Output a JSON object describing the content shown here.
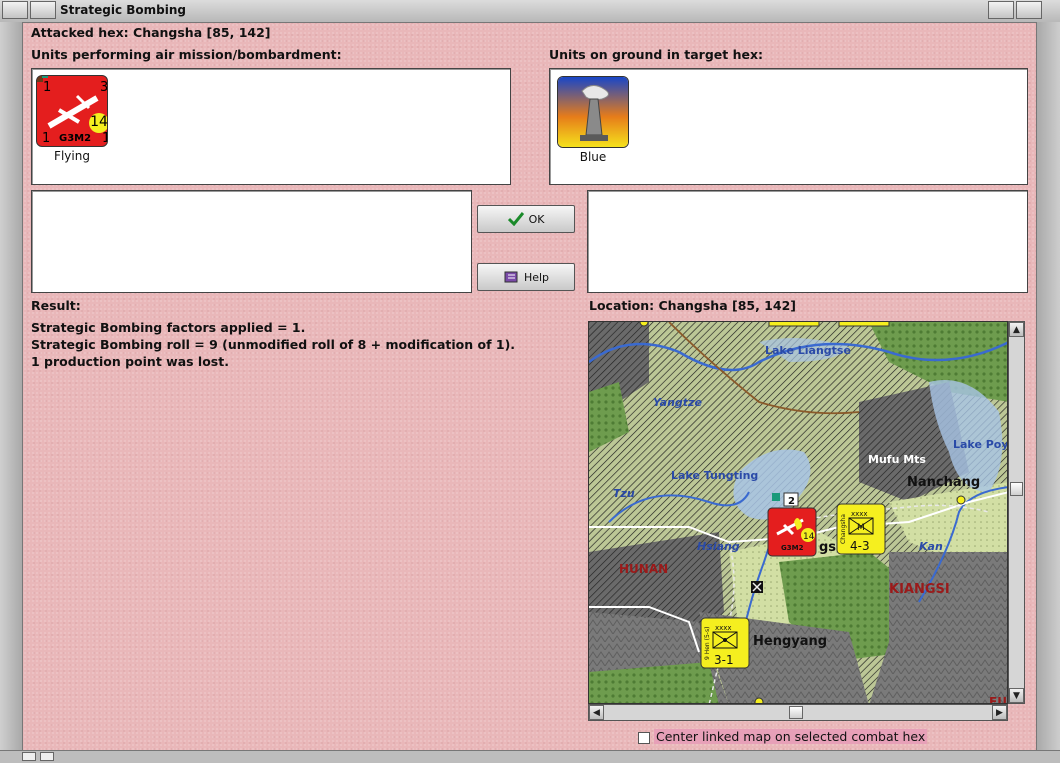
{
  "window": {
    "title": "Strategic Bombing"
  },
  "header": {
    "attacked_hex": "Attacked hex: Changsha  [85, 142]"
  },
  "air_units": {
    "label": "Units performing air mission/bombardment:",
    "items": [
      {
        "type": "G3M2",
        "status": "Flying",
        "left_value": "1",
        "top_right_value": "3",
        "bottom_left_value": "1",
        "bottom_right_value": "1",
        "range": "14",
        "color": "#e41e1e"
      }
    ]
  },
  "ground_units": {
    "label": "Units on ground in target hex:",
    "items": [
      {
        "status": "Blue"
      }
    ]
  },
  "buttons": {
    "ok_label": "OK",
    "help_label": "Help"
  },
  "result": {
    "label": "Result:",
    "lines": [
      "Strategic Bombing factors applied = 1.",
      "Strategic Bombing roll = 9 (unmodified roll of 8 + modification of 1).",
      "1 production point was lost."
    ]
  },
  "location": {
    "label": "Location:  Changsha  [85, 142]"
  },
  "map": {
    "labels": {
      "lake_liangtse": "Lake Liangtse",
      "yangtze": "Yangtze",
      "lake_poy": "Lake Poy",
      "mufu_mts": "Mufu Mts",
      "nanchang": "Nanchang",
      "lake_tungting": "Lake Tungting",
      "tzu": "Tzu",
      "hsiang": "Hsiang",
      "kan": "Kan",
      "hunan": "HUNAN",
      "kiangsi": "KIANGSI",
      "hengyang": "Hengyang",
      "changsha_partial": "gs",
      "fu_partial": "FU"
    },
    "counters": {
      "bomber_stack": "2",
      "bomber_type": "G3M2",
      "bomber_range": "14",
      "army1_size": "xxxx",
      "army1_value": "4-3",
      "army1_name": "Changsha",
      "army1_letter": "M",
      "army2_size": "xxxx",
      "army2_value": "3-1",
      "army2_name": "9 Hen (5-s)"
    }
  },
  "options": {
    "center_map_label": "Center linked map on selected combat hex",
    "center_map_checked": false
  },
  "colors": {
    "background": "#e9b7b9",
    "axis_red": "#e41e1e",
    "allied_yellow": "#f5ef1f"
  }
}
